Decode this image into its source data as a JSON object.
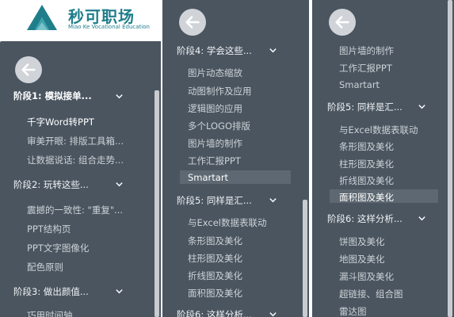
{
  "panel1": {
    "logo_cn": "秒可职场",
    "logo_en": "Miao Ke Vocational Education",
    "items": [
      {
        "label": "阶段1:  模拟接单..."
      },
      {
        "label": "千字Word转PPT"
      },
      {
        "label": "审美开眼:  排版工具箱..."
      },
      {
        "label": "让数据说话:  组合走势..."
      },
      {
        "label": "阶段2:  玩转这些..."
      },
      {
        "label": "震撼的一致性:  \"重复\"..."
      },
      {
        "label": "PPT结构页"
      },
      {
        "label": "PPT文字图像化"
      },
      {
        "label": "配色原则"
      },
      {
        "label": "阶段3:  做出颜值..."
      },
      {
        "label": "巧用时间轴"
      }
    ]
  },
  "panel2": {
    "items": [
      {
        "label": "阶段4:  学会这些..."
      },
      {
        "label": "图片动态缩放"
      },
      {
        "label": "动图制作及应用"
      },
      {
        "label": "逻辑图的应用"
      },
      {
        "label": "多个LOGO排版"
      },
      {
        "label": "图片墙的制作"
      },
      {
        "label": "工作汇报PPT"
      },
      {
        "label": "Smartart"
      },
      {
        "label": "阶段5:  同样是汇..."
      },
      {
        "label": "与Excel数据表联动"
      },
      {
        "label": "条形图及美化"
      },
      {
        "label": "柱形图及美化"
      },
      {
        "label": "折线图及美化"
      },
      {
        "label": "面积图及美化"
      },
      {
        "label": "阶段6:  这样分析..."
      }
    ]
  },
  "panel3": {
    "items": [
      {
        "label": "图片墙的制作"
      },
      {
        "label": "工作汇报PPT"
      },
      {
        "label": "Smartart"
      },
      {
        "label": "阶段5:  同样是汇..."
      },
      {
        "label": "与Excel数据表联动"
      },
      {
        "label": "条形图及美化"
      },
      {
        "label": "柱形图及美化"
      },
      {
        "label": "折线图及美化"
      },
      {
        "label": "面积图及美化"
      },
      {
        "label": "阶段6:  这样分析..."
      },
      {
        "label": "饼图及美化"
      },
      {
        "label": "地图及美化"
      },
      {
        "label": "漏斗图及美化"
      },
      {
        "label": "超链接、组合图"
      },
      {
        "label": "雷达图"
      }
    ]
  },
  "colors": {
    "panel_bg": "#4a5560",
    "highlight": "#5d6872",
    "brand": "#1f7e8a"
  }
}
